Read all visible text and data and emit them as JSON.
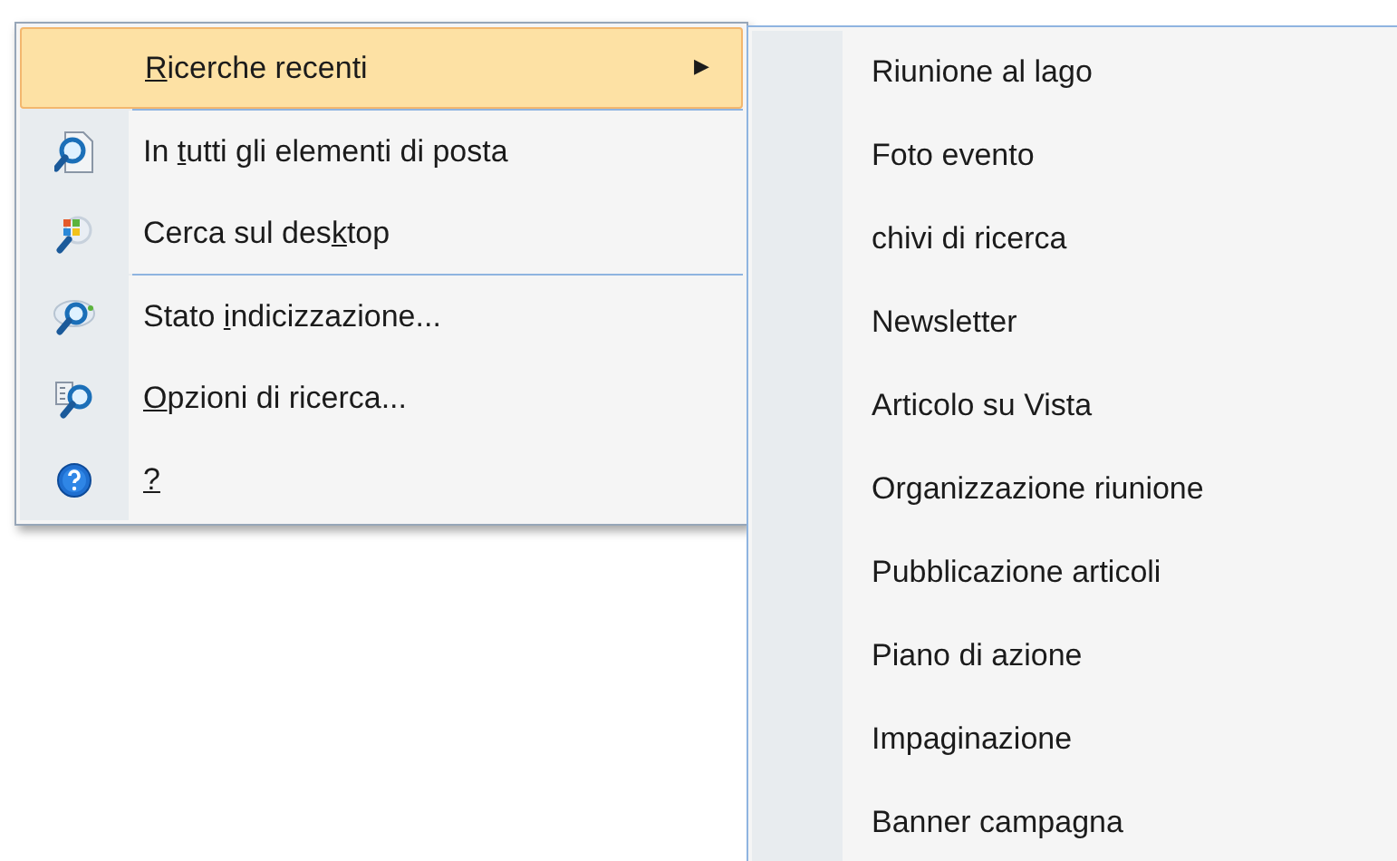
{
  "menu": {
    "items": [
      {
        "kind": "submenu",
        "accelerator": "R",
        "after": "icerche recenti",
        "arrow": "▶",
        "selected": true
      },
      {
        "kind": "separator"
      },
      {
        "kind": "command",
        "before": "In ",
        "accelerator": "t",
        "after": "utti gli elementi di posta",
        "selected": false
      },
      {
        "kind": "command",
        "before": "Cerca sul des",
        "accelerator": "k",
        "after": "top",
        "selected": false
      },
      {
        "kind": "separator"
      },
      {
        "kind": "command",
        "before": "Stato ",
        "accelerator": "i",
        "after": "ndicizzazione...",
        "selected": false
      },
      {
        "kind": "command",
        "accelerator": "O",
        "after": "pzioni di ricerca...",
        "selected": false
      },
      {
        "kind": "command",
        "accelerator": "?",
        "selected": false
      }
    ]
  },
  "submenu": {
    "items": [
      {
        "label": "Riunione al lago",
        "selected": false
      },
      {
        "label": "Foto evento",
        "selected": false
      },
      {
        "label": "chivi di ricerca",
        "selected": false
      },
      {
        "label": "Newsletter",
        "selected": false
      },
      {
        "label": "Articolo su Vista",
        "selected": false
      },
      {
        "label": "Organizzazione riunione",
        "selected": false
      },
      {
        "label": "Pubblicazione articoli",
        "selected": false
      },
      {
        "label": "Piano di azione",
        "selected": false
      },
      {
        "label": "Impaginazione",
        "selected": false
      },
      {
        "label": "Banner campagna",
        "selected": false
      }
    ]
  }
}
